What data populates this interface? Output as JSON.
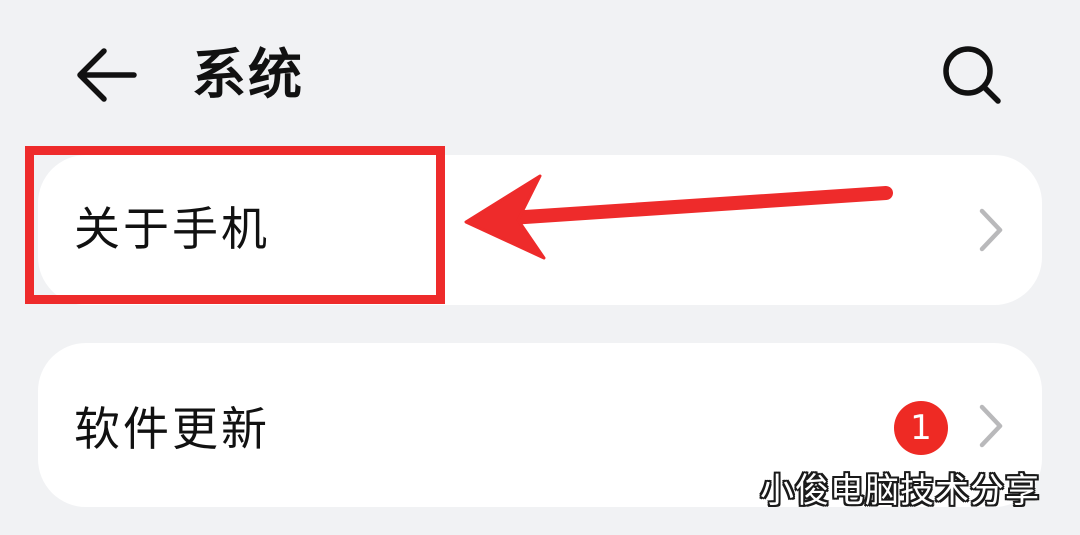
{
  "header": {
    "back_icon": "arrow-left-icon",
    "title": "系统",
    "search_icon": "search-icon"
  },
  "settings_items": [
    {
      "label": "关于手机",
      "chevron_icon": "chevron-right-icon",
      "highlighted": true
    },
    {
      "label": "软件更新",
      "badge": "1",
      "chevron_icon": "chevron-right-icon"
    }
  ],
  "annotation": {
    "color": "#ee2b2b",
    "arrow_icon": "arrow-left-icon"
  },
  "watermark": "小俊电脑技术分享",
  "colors": {
    "background": "#f1f2f4",
    "card": "#ffffff",
    "badge": "#ee2a24",
    "annotation": "#ee2b2b"
  }
}
